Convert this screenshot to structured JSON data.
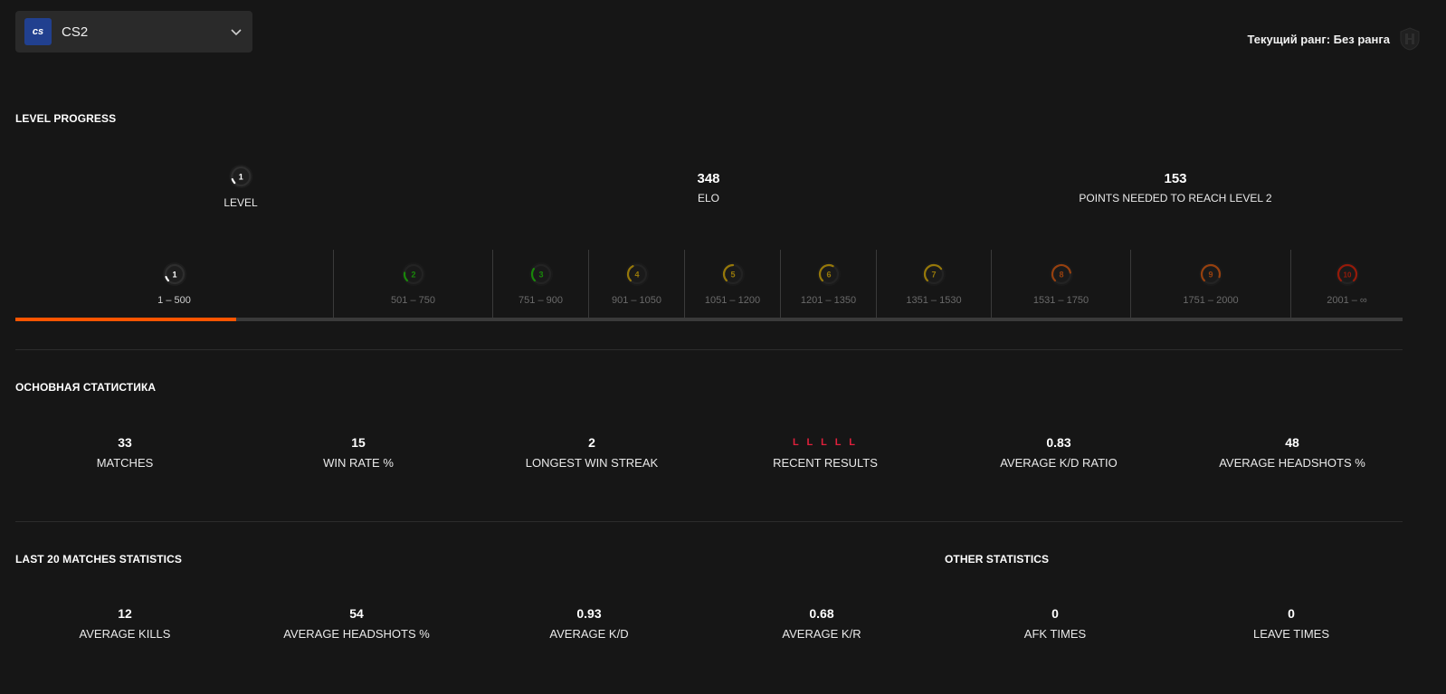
{
  "game": {
    "name": "CS2",
    "logo_text": "cs",
    "brand_color": "#21408f"
  },
  "rank": {
    "text": "Текущий ранг: Без ранга"
  },
  "level_progress": {
    "title": "LEVEL PROGRESS",
    "level_value": "1",
    "level_label": "LEVEL",
    "elo_value": "348",
    "elo_label": "ELO",
    "points_value": "153",
    "points_label": "POINTS NEEDED TO REACH LEVEL 2",
    "progress_fraction": 0.696,
    "accent_color": "#ff5500",
    "levels": [
      {
        "level": "1",
        "range": "1 – 500",
        "color": "#ffffff",
        "fill": 0.1
      },
      {
        "level": "2",
        "range": "501 – 750",
        "color": "#1ce400",
        "fill": 0.2
      },
      {
        "level": "3",
        "range": "751 – 900",
        "color": "#1ce400",
        "fill": 0.3
      },
      {
        "level": "4",
        "range": "901 – 1050",
        "color": "#ffc800",
        "fill": 0.4
      },
      {
        "level": "5",
        "range": "1051 – 1200",
        "color": "#ffc800",
        "fill": 0.5
      },
      {
        "level": "6",
        "range": "1201 – 1350",
        "color": "#ffc800",
        "fill": 0.6
      },
      {
        "level": "7",
        "range": "1351 – 1530",
        "color": "#ffc800",
        "fill": 0.7
      },
      {
        "level": "8",
        "range": "1531 – 1750",
        "color": "#ff6309",
        "fill": 0.8
      },
      {
        "level": "9",
        "range": "1751 – 2000",
        "color": "#ff6309",
        "fill": 0.9
      },
      {
        "level": "10",
        "range": "2001 – ∞",
        "color": "#fe1f00",
        "fill": 1.0
      }
    ]
  },
  "main_stats": {
    "title": "ОСНОВНАЯ СТАТИСТИКА",
    "items": [
      {
        "value": "33",
        "label": "MATCHES"
      },
      {
        "value": "15",
        "label": "WIN RATE %"
      },
      {
        "value": "2",
        "label": "LONGEST WIN STREAK"
      },
      {
        "value": "L L L L L",
        "label": "RECENT RESULTS"
      },
      {
        "value": "0.83",
        "label": "AVERAGE K/D RATIO"
      },
      {
        "value": "48",
        "label": "AVERAGE HEADSHOTS %"
      }
    ]
  },
  "last20": {
    "title": "LAST 20 MATCHES STATISTICS",
    "items": [
      {
        "value": "12",
        "label": "AVERAGE KILLS"
      },
      {
        "value": "54",
        "label": "AVERAGE HEADSHOTS %"
      },
      {
        "value": "0.93",
        "label": "AVERAGE K/D"
      },
      {
        "value": "0.68",
        "label": "AVERAGE K/R"
      }
    ]
  },
  "other": {
    "title": "OTHER STATISTICS",
    "items": [
      {
        "value": "0",
        "label": "AFK TIMES"
      },
      {
        "value": "0",
        "label": "LEAVE TIMES"
      }
    ]
  },
  "colors": {
    "loss": "#e0203c",
    "background": "#161616"
  }
}
